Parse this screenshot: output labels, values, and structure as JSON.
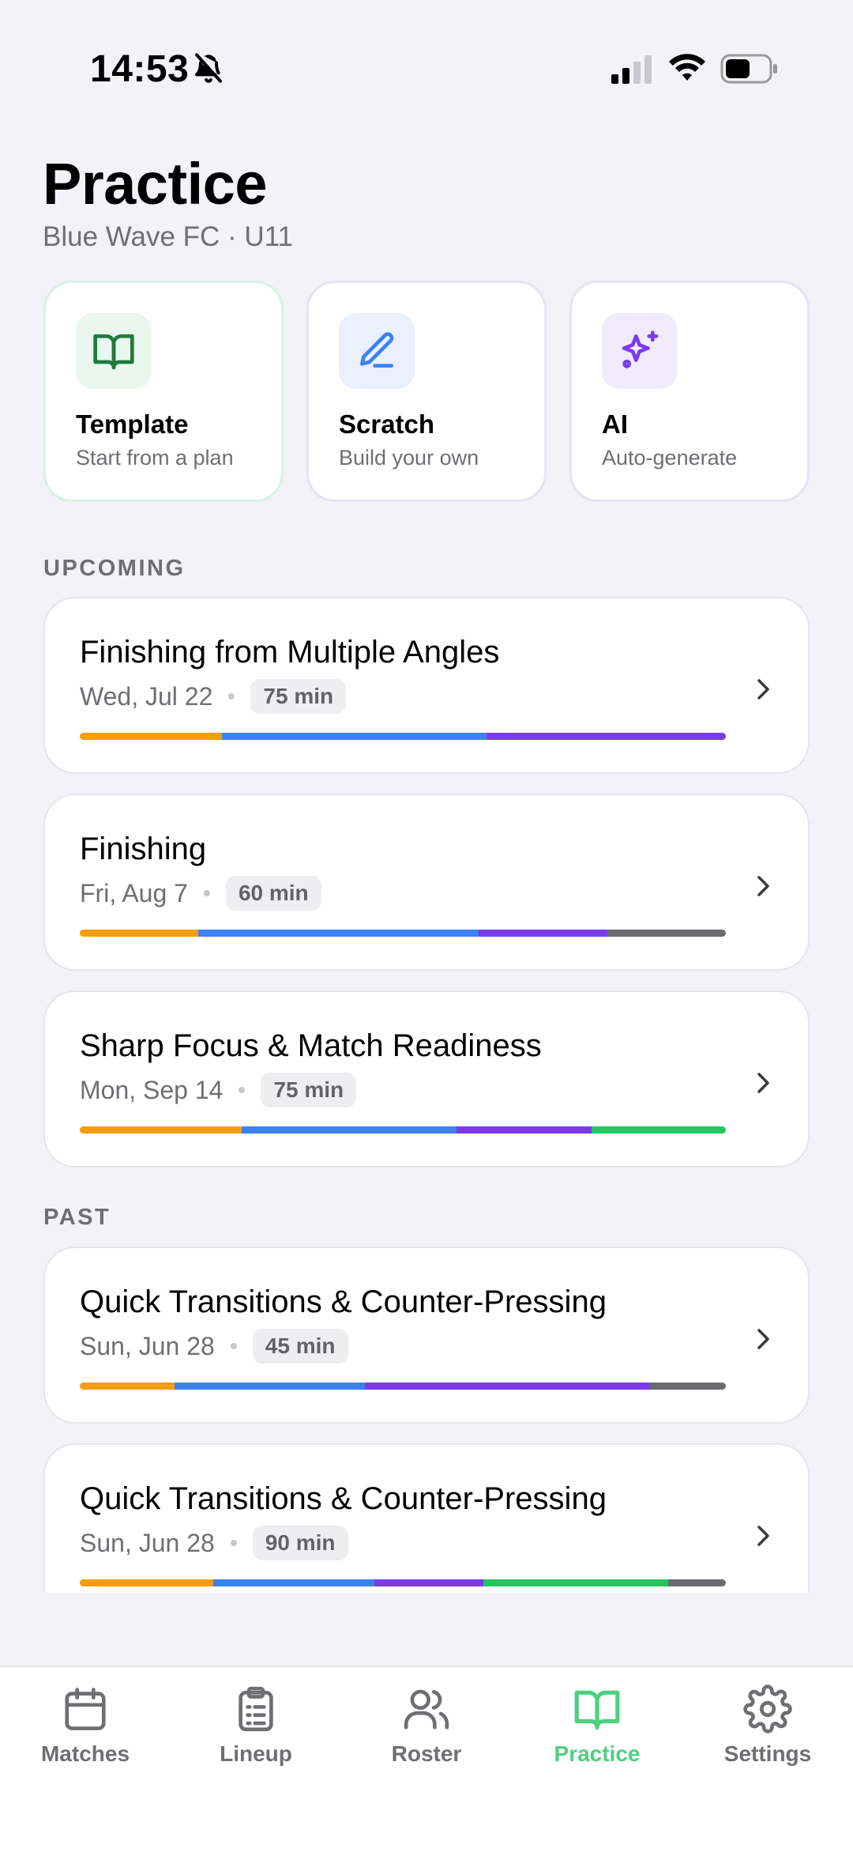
{
  "status_bar": {
    "time": "14:53",
    "icons": [
      "bell-off-icon",
      "cellular-signal-icon",
      "wifi-icon",
      "battery-icon"
    ]
  },
  "header": {
    "title": "Practice",
    "subtitle": "Blue Wave FC · U11"
  },
  "create_options": [
    {
      "title": "Template",
      "description": "Start from a plan",
      "icon": "book-open-icon",
      "accent": "#1e7a3e"
    },
    {
      "title": "Scratch",
      "description": "Build your own",
      "icon": "pencil-icon",
      "accent": "#3b82f6"
    },
    {
      "title": "AI",
      "description": "Auto-generate",
      "icon": "sparkles-icon",
      "accent": "#7c3aed"
    }
  ],
  "sections": {
    "upcoming_label": "UPCOMING",
    "past_label": "PAST"
  },
  "upcoming": [
    {
      "title": "Finishing from Multiple Angles",
      "date": "Wed, Jul 22",
      "duration": "75 min",
      "segments": [
        {
          "color": "#f59e0b",
          "share": 0.22
        },
        {
          "color": "#3b82f6",
          "share": 0.41
        },
        {
          "color": "#7c3aed",
          "share": 0.37
        }
      ]
    },
    {
      "title": "Finishing",
      "date": "Fri, Aug 7",
      "duration": "60 min",
      "segments": [
        {
          "color": "#f59e0b",
          "share": 0.183
        },
        {
          "color": "#3b82f6",
          "share": 0.434
        },
        {
          "color": "#7c3aed",
          "share": 0.2
        },
        {
          "color": "#6b6b70",
          "share": 0.183
        }
      ]
    },
    {
      "title": "Sharp Focus & Match Readiness",
      "date": "Mon, Sep 14",
      "duration": "75 min",
      "segments": [
        {
          "color": "#f59e0b",
          "share": 0.25
        },
        {
          "color": "#3b82f6",
          "share": 0.333
        },
        {
          "color": "#7c3aed",
          "share": 0.209
        },
        {
          "color": "#22c55e",
          "share": 0.208
        }
      ]
    }
  ],
  "past": [
    {
      "title": "Quick Transitions & Counter-Pressing",
      "date": "Sun, Jun 28",
      "duration": "45 min",
      "segments": [
        {
          "color": "#f59e0b",
          "share": 0.147
        },
        {
          "color": "#3b82f6",
          "share": 0.294
        },
        {
          "color": "#7c3aed",
          "share": 0.44
        },
        {
          "color": "#6b6b70",
          "share": 0.119
        }
      ]
    },
    {
      "title": "Quick Transitions & Counter-Pressing",
      "date": "Sun, Jun 28",
      "duration": "90 min",
      "segments": [
        {
          "color": "#f59e0b",
          "share": 0.206
        },
        {
          "color": "#3b82f6",
          "share": 0.25
        },
        {
          "color": "#7c3aed",
          "share": 0.169
        },
        {
          "color": "#22c55e",
          "share": 0.286
        },
        {
          "color": "#6b6b70",
          "share": 0.089
        }
      ]
    }
  ],
  "tab_bar": {
    "active": "Practice",
    "active_color": "#4cd080",
    "tabs": [
      {
        "label": "Matches",
        "icon": "calendar-icon"
      },
      {
        "label": "Lineup",
        "icon": "clipboard-icon"
      },
      {
        "label": "Roster",
        "icon": "users-icon"
      },
      {
        "label": "Practice",
        "icon": "book-open-icon"
      },
      {
        "label": "Settings",
        "icon": "gear-icon"
      }
    ]
  }
}
